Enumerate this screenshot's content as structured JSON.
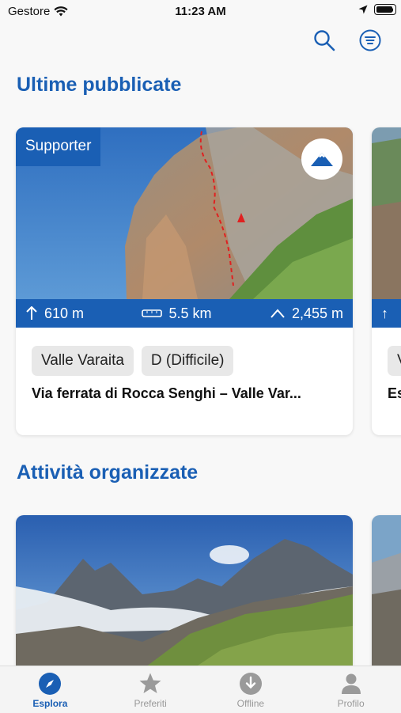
{
  "status_bar": {
    "carrier": "Gestore",
    "time": "11:23 AM"
  },
  "header": {
    "icons": [
      "search-icon",
      "filter-icon"
    ]
  },
  "sections": {
    "latest": {
      "title": "Ultime pubblicate"
    },
    "organized": {
      "title": "Attività organizzate"
    }
  },
  "card1": {
    "badge": "Supporter",
    "category_icon": "mountain-icon",
    "stats": {
      "elevation": "610 m",
      "distance": "5.5 km",
      "altitude": "2,455 m"
    },
    "tags": [
      "Valle Varaita",
      "D (Difficile)"
    ],
    "title": "Via ferrata di Rocca Senghi – Valle Var..."
  },
  "card1_peek": {
    "stat": "↑",
    "tag": "V",
    "title": "Es"
  },
  "tabbar": {
    "tabs": [
      {
        "label": "Esplora",
        "icon": "compass-icon",
        "active": true
      },
      {
        "label": "Preferiti",
        "icon": "star-icon",
        "active": false
      },
      {
        "label": "Offline",
        "icon": "download-icon",
        "active": false
      },
      {
        "label": "Profilo",
        "icon": "person-icon",
        "active": false
      }
    ]
  },
  "colors": {
    "accent": "#1a5fb4",
    "inactive": "#999999"
  }
}
